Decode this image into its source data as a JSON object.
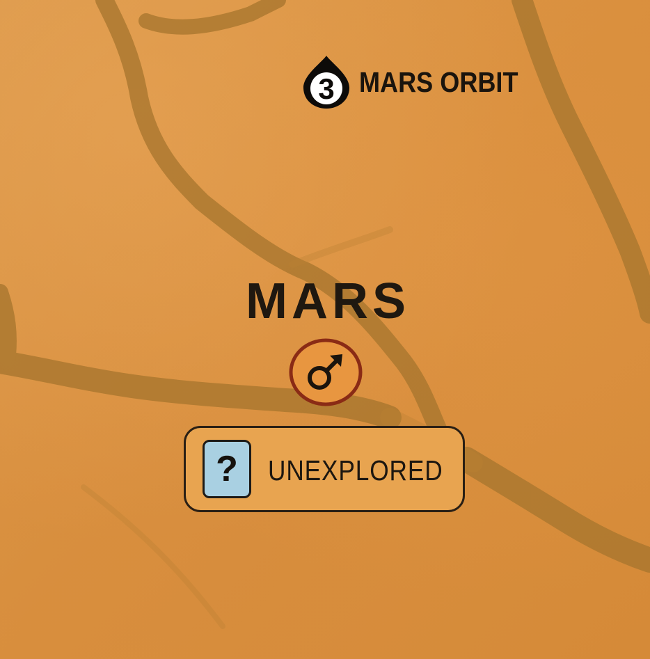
{
  "orbit": {
    "number": "3",
    "label": "MARS ORBIT"
  },
  "planet": {
    "name": "MARS",
    "symbol": "mars-symbol-icon"
  },
  "status": {
    "icon_text": "?",
    "label": "UNEXPLORED"
  },
  "colors": {
    "background": "#d9913f",
    "terrain_dark": "#a8762e",
    "symbol_circle": "#e89640",
    "symbol_border": "#8a2b15",
    "status_box": "#e8a450",
    "status_icon": "#a9d0e2",
    "text": "#1f1810"
  }
}
